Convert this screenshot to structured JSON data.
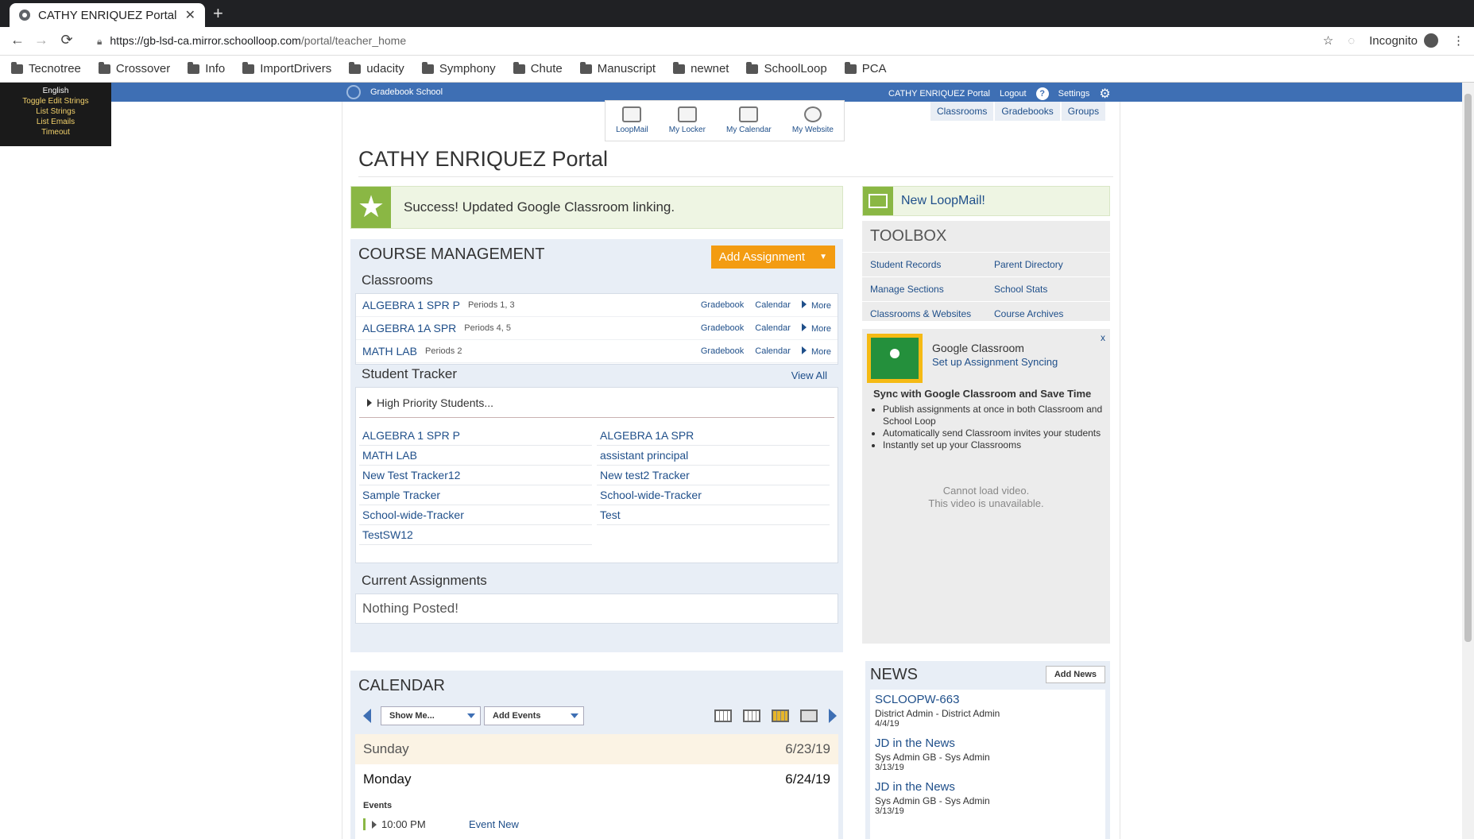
{
  "browser": {
    "tab_title": "CATHY ENRIQUEZ Portal",
    "url_host": "https://gb-lsd-ca.mirror.schoolloop.com",
    "url_path": "/portal/teacher_home",
    "profile": "Incognito",
    "bookmarks": [
      "Tecnotree",
      "Crossover",
      "Info",
      "ImportDrivers",
      "udacity",
      "Symphony",
      "Chute",
      "Manuscript",
      "newnet",
      "SchoolLoop",
      "PCA"
    ]
  },
  "dev_panel": [
    "English",
    "Toggle Edit Strings",
    "List Strings",
    "List Emails",
    "Timeout"
  ],
  "topbar": {
    "school": "Gradebook School",
    "portal_name": "CATHY ENRIQUEZ Portal",
    "logout": "Logout",
    "help": "?",
    "settings": "Settings"
  },
  "apps": [
    "LoopMail",
    "My Locker",
    "My Calendar",
    "My Website"
  ],
  "right_tabs": [
    "Classrooms",
    "Gradebooks",
    "Groups"
  ],
  "page_title": "CATHY ENRIQUEZ Portal",
  "success_message": "Success! Updated Google Classroom linking.",
  "course_management": {
    "heading": "COURSE MANAGEMENT",
    "add_assignment": "Add Assignment",
    "classrooms_heading": "Classrooms",
    "classrooms": [
      {
        "name": "ALGEBRA 1 SPR P",
        "periods": "Periods 1, 3",
        "gradebook": "Gradebook",
        "calendar": "Calendar",
        "more": "More"
      },
      {
        "name": "ALGEBRA 1A SPR",
        "periods": "Periods 4, 5",
        "gradebook": "Gradebook",
        "calendar": "Calendar",
        "more": "More"
      },
      {
        "name": "MATH LAB",
        "periods": "Periods 2",
        "gradebook": "Gradebook",
        "calendar": "Calendar",
        "more": "More"
      }
    ],
    "tracker_heading": "Student Tracker",
    "view_all": "View All",
    "high_priority": "High Priority Students...",
    "trackers": [
      "ALGEBRA 1 SPR P",
      "ALGEBRA 1A SPR",
      "MATH LAB",
      "assistant principal",
      "New Test Tracker12",
      "New test2 Tracker",
      "Sample Tracker",
      "School-wide-Tracker",
      "School-wide-Tracker",
      "Test",
      "TestSW12"
    ],
    "assignments_heading": "Current Assignments",
    "nothing_posted": "Nothing Posted!"
  },
  "calendar": {
    "heading": "CALENDAR",
    "show_me": "Show Me...",
    "add_events": "Add Events",
    "days": [
      {
        "name": "Sunday",
        "date": "6/23/19"
      },
      {
        "name": "Monday",
        "date": "6/24/19"
      }
    ],
    "events_label": "Events",
    "event_time": "10:00 PM",
    "event_name": "Event New"
  },
  "new_loopmail": "New LoopMail!",
  "toolbox": {
    "heading": "TOOLBOX",
    "links": [
      "Student Records",
      "Parent Directory",
      "Manage Sections",
      "School Stats",
      "Classrooms & Websites",
      "Course Archives"
    ]
  },
  "google_classroom": {
    "close": "x",
    "title": "Google Classroom",
    "link": "Set up Assignment Syncing",
    "sync": "Sync with Google Classroom and Save Time",
    "bullets": [
      "Publish assignments at once in both Classroom and School Loop",
      "Automatically send Classroom invites your students",
      "Instantly set up your Classrooms"
    ],
    "video1": "Cannot load video.",
    "video2": "This video is unavailable."
  },
  "news": {
    "heading": "NEWS",
    "add": "Add News",
    "items": [
      {
        "title": "SCLOOPW-663",
        "by": "District Admin - District Admin",
        "date": "4/4/19"
      },
      {
        "title": "JD in the News",
        "by": "Sys Admin GB - Sys Admin",
        "date": "3/13/19"
      },
      {
        "title": "JD in the News",
        "by": "Sys Admin GB - Sys Admin",
        "date": "3/13/19"
      }
    ]
  }
}
